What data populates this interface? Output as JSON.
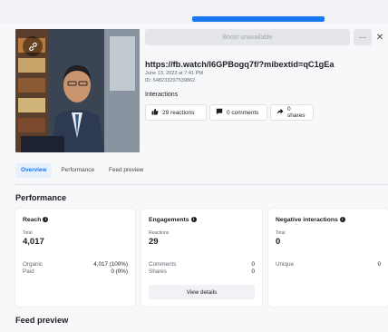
{
  "header": {
    "boost_label": "Boost unavailable",
    "more_label": "···",
    "close_label": "✕"
  },
  "post": {
    "url": "https://fb.watch/l6GPBogq7f/?mibextid=qC1gEa",
    "date": "June 13, 2023 at 7:41 PM",
    "id": "ID: 648233297539862",
    "interactions_label": "Interactions",
    "reactions": "29 reactions",
    "comments": "0 comments",
    "shares": "0 shares"
  },
  "icons": {
    "thumbnail_badge": "link-icon",
    "reactions": "thumbs-up-icon",
    "comments": "comment-icon",
    "shares": "share-icon",
    "info": "info-icon"
  },
  "tabs": [
    {
      "label": "Overview",
      "active": true
    },
    {
      "label": "Performance",
      "active": false
    },
    {
      "label": "Feed preview",
      "active": false
    }
  ],
  "performance": {
    "title": "Performance",
    "reach": {
      "title": "Reach",
      "sub_label": "Total",
      "value": "4,017",
      "rows": [
        {
          "label": "Organic",
          "value": "4,017 (100%)"
        },
        {
          "label": "Paid",
          "value": "0 (0%)"
        }
      ]
    },
    "engagements": {
      "title": "Engagements",
      "sub_label": "Reactions",
      "value": "29",
      "rows": [
        {
          "label": "Comments",
          "value": "0"
        },
        {
          "label": "Shares",
          "value": "0"
        }
      ],
      "button": "View details"
    },
    "negative": {
      "title": "Negative interactions",
      "sub_label": "Total",
      "value": "0",
      "rows": [
        {
          "label": "Unique",
          "value": "0"
        }
      ]
    }
  },
  "feed_preview": {
    "title": "Feed preview"
  },
  "colors": {
    "accent": "#1877f2",
    "panel_bg": "#f7f8fa",
    "card_bg": "#ffffff"
  }
}
